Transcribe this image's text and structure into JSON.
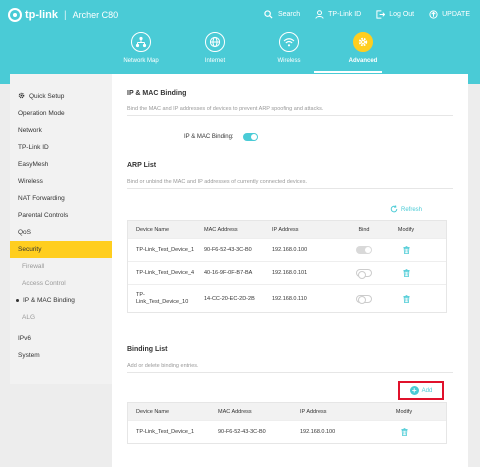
{
  "brand": {
    "logo": "tp-link",
    "separator": "|",
    "model": "Archer C80"
  },
  "top_actions": [
    {
      "label": "Search",
      "icon": "search-icon"
    },
    {
      "label": "TP-Link ID",
      "icon": "person-icon"
    },
    {
      "label": "Log Out",
      "icon": "logout-icon"
    },
    {
      "label": "UPDATE",
      "icon": "update-icon"
    }
  ],
  "main_nav": [
    {
      "label": "Network Map",
      "icon": "network-map-icon"
    },
    {
      "label": "Internet",
      "icon": "globe-icon"
    },
    {
      "label": "Wireless",
      "icon": "wifi-icon"
    },
    {
      "label": "Advanced",
      "icon": "gear-icon",
      "active": true
    }
  ],
  "sidebar": {
    "items": [
      {
        "label": "Quick Setup"
      },
      {
        "label": "Operation Mode"
      },
      {
        "label": "Network"
      },
      {
        "label": "TP-Link ID"
      },
      {
        "label": "EasyMesh"
      },
      {
        "label": "Wireless"
      },
      {
        "label": "NAT Forwarding"
      },
      {
        "label": "Parental Controls"
      },
      {
        "label": "QoS"
      },
      {
        "label": "Security",
        "active": true
      }
    ],
    "sub_items": [
      {
        "label": "Firewall"
      },
      {
        "label": "Access Control"
      },
      {
        "label": "IP & MAC Binding",
        "active": true
      },
      {
        "label": "ALG"
      }
    ],
    "after_items": [
      {
        "label": "IPv6"
      },
      {
        "label": "System"
      }
    ]
  },
  "binding_section": {
    "title": "IP & MAC Binding",
    "desc": "Bind the MAC and IP addresses of devices to prevent ARP spoofing and attacks.",
    "toggle_label": "IP & MAC Binding:",
    "enabled": true
  },
  "arp_section": {
    "title": "ARP List",
    "desc": "Bind or unbind the MAC and IP addresses of currently connected devices.",
    "refresh_label": "Refresh",
    "headers": [
      "Device Name",
      "MAC Address",
      "IP Address",
      "Bind",
      "Modify"
    ],
    "rows": [
      {
        "name": "TP-Link_Test_Device_1",
        "mac": "90-F6-52-43-3C-B0",
        "ip": "192.168.0.100",
        "bind": true
      },
      {
        "name": "TP-Link_Test_Device_4",
        "mac": "40-16-9F-0F-B7-BA",
        "ip": "192.168.0.101",
        "bind": false
      },
      {
        "name_line1": "TP-",
        "name_line2": "Link_Test_Device_10",
        "mac": "14-CC-20-EC-2D-2B",
        "ip": "192.168.0.110",
        "bind": false
      }
    ]
  },
  "binding_list": {
    "title": "Binding List",
    "desc": "Add or delete binding entries.",
    "add_label": "Add",
    "headers": [
      "Device Name",
      "MAC Address",
      "IP Address",
      "Modify"
    ],
    "rows": [
      {
        "name": "TP-Link_Test_Device_1",
        "mac": "90-F6-52-43-3C-B0",
        "ip": "192.168.0.100"
      }
    ]
  },
  "colors": {
    "brand": "#4acbd6",
    "active": "#ffce1f",
    "highlight": "#e0112b"
  }
}
